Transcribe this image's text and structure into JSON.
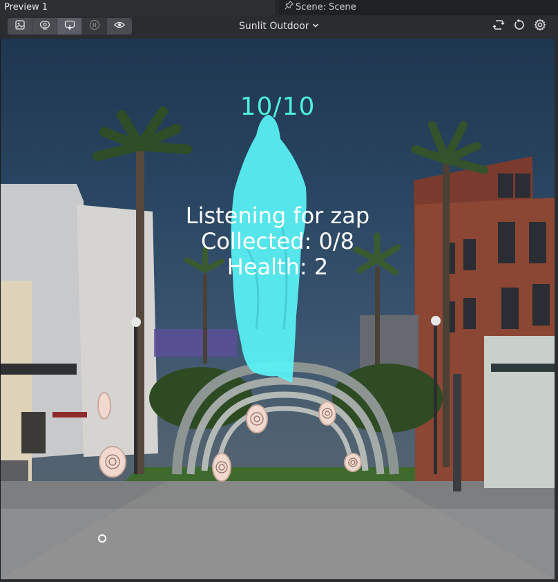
{
  "tabs": {
    "preview_label": "Preview 1",
    "scene_label": "Scene: Scene"
  },
  "toolbar": {
    "buttons": [
      {
        "icon": "image-icon"
      },
      {
        "icon": "camera-view-icon"
      },
      {
        "icon": "interactive-icon"
      },
      {
        "icon": "pause-icon"
      },
      {
        "icon": "eye-icon"
      }
    ],
    "environment": "Sunlit Outdoor",
    "right_icons": [
      "sync-icon",
      "restart-icon",
      "settings-icon"
    ]
  },
  "hud": {
    "score": "10/10",
    "status_line": "Listening for zap",
    "collected_line": "Collected: 0/8",
    "health_line": "Health: 2"
  },
  "colors": {
    "hud_score": "#4df2dc",
    "ghost": "#59f3f6",
    "hud_text": "#ffffff"
  }
}
